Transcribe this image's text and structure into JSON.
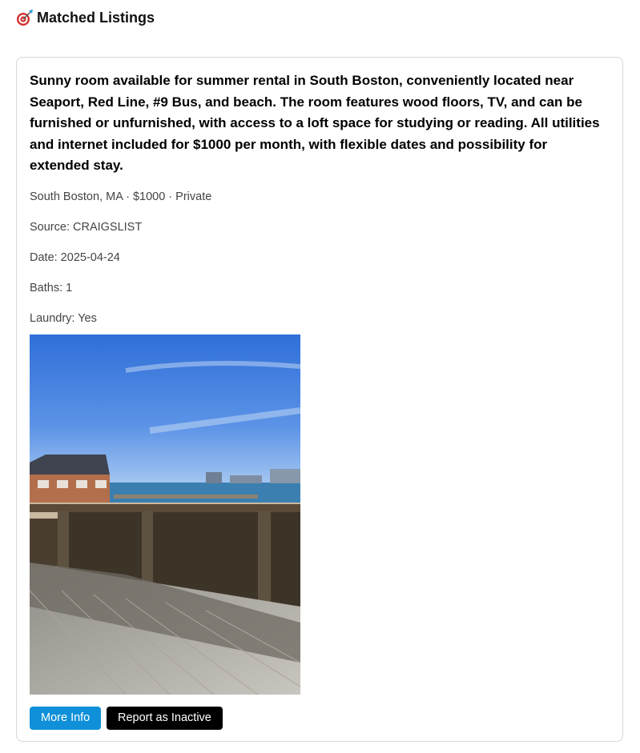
{
  "page": {
    "title": "Matched Listings",
    "title_icon": "target-icon"
  },
  "listing": {
    "description": "Sunny room available for summer rental in South Boston, conveniently located near Seaport, Red Line, #9 Bus, and beach. The room features wood floors, TV, and can be furnished or unfurnished, with access to a loft space for studying or reading. All utilities and internet included for $1000 per month, with flexible dates and possibility for extended stay.",
    "summary": "South Boston, MA · $1000 · Private",
    "source": "Source: CRAIGSLIST",
    "date": "Date: 2025-04-24",
    "baths": "Baths: 1",
    "laundry": "Laundry: Yes",
    "photo": "waterfront-deck-photo",
    "more_info_label": "More Info",
    "report_label": "Report as Inactive"
  },
  "colors": {
    "primary_button": "#0f90d9",
    "report_button": "#000000",
    "card_border": "#d8d8d8"
  }
}
